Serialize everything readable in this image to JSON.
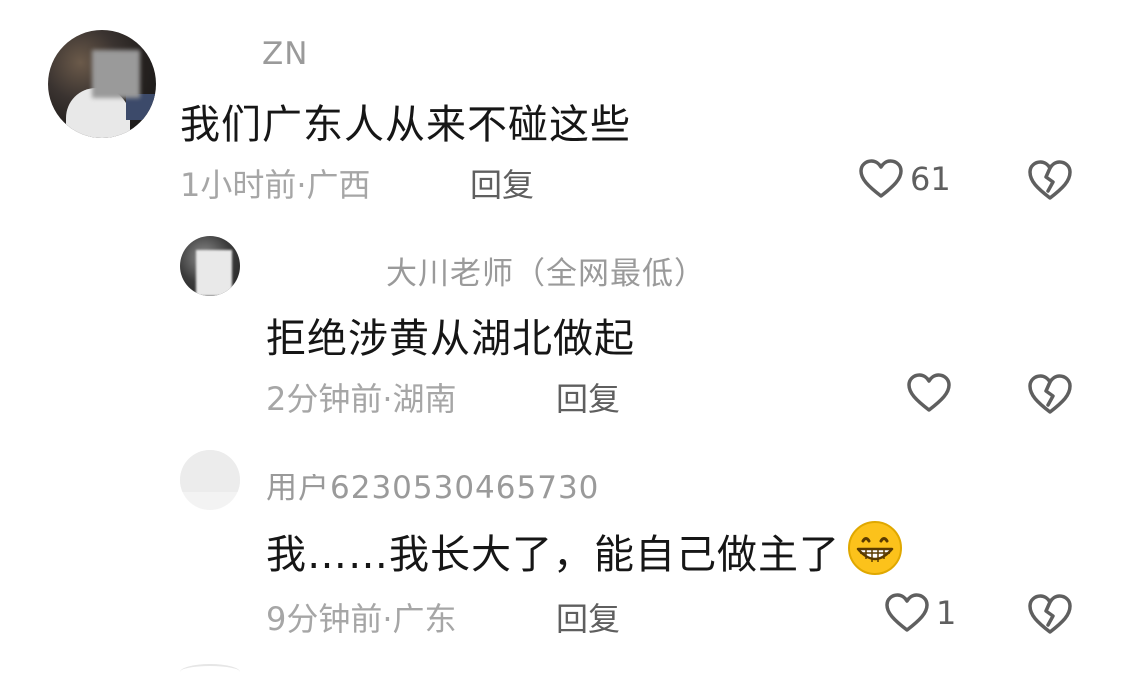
{
  "comments": [
    {
      "username": "ZN",
      "content": "我们广东人从来不碰这些",
      "time_location": "1小时前·广西",
      "reply_label": "回复",
      "like_count": "61",
      "has_dislike": true
    },
    {
      "username": "大川老师（全网最低）",
      "content": "拒绝涉黄从湖北做起",
      "time_location": "2分钟前·湖南",
      "reply_label": "回复",
      "like_count": "",
      "has_dislike": true
    },
    {
      "username": "用户6230530465730",
      "content": "我……我长大了，能自己做主了",
      "emoji": "grinning-face-emoji",
      "time_location": "9分钟前·广东",
      "reply_label": "回复",
      "like_count": "1",
      "has_dislike": true
    }
  ],
  "colors": {
    "text_primary": "#161616",
    "text_secondary": "#a6a6a6",
    "text_action": "#5f5f5f",
    "icon_stroke": "#5f5f5f"
  }
}
